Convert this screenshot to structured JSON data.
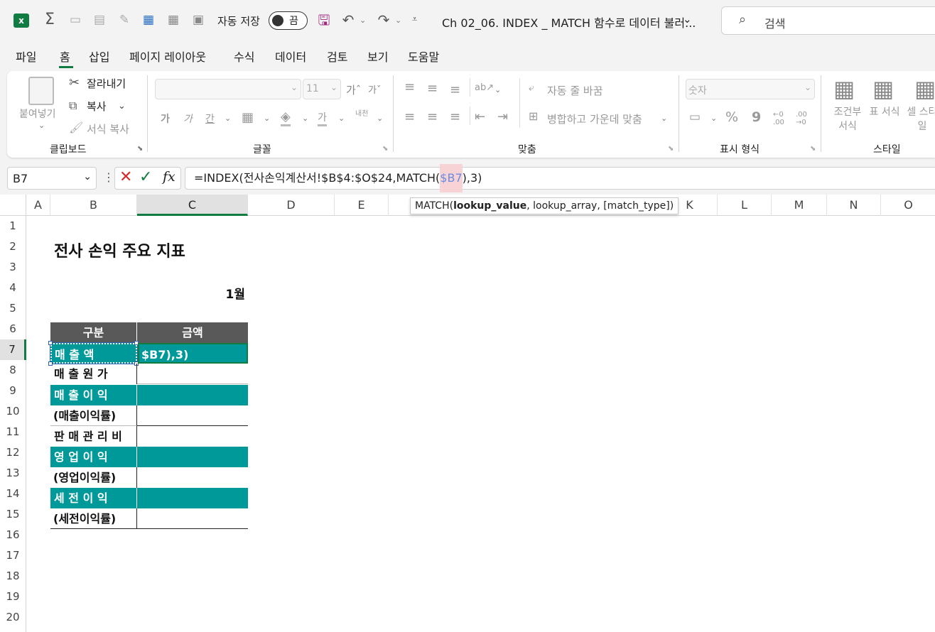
{
  "titlebar": {
    "autosave_label": "자동 저장",
    "autosave_state": "끔",
    "doc_title": "Ch 02_06. INDEX _ MATCH 함수로 데이터 불러...",
    "search_placeholder": "검색"
  },
  "menu": [
    "파일",
    "홈",
    "삽입",
    "페이지 레이아웃",
    "수식",
    "데이터",
    "검토",
    "보기",
    "도움말"
  ],
  "ribbon": {
    "clipboard": {
      "paste": "붙여넣기",
      "cut": "잘라내기",
      "copy": "복사",
      "format_painter": "서식 복사",
      "group": "클립보드"
    },
    "font": {
      "size": "11",
      "bold": "가",
      "italic": "가",
      "underline": "간",
      "font_color": "가",
      "phonetic": "내천",
      "group": "글꼴"
    },
    "alignment": {
      "wrap": "자동 줄 바꿈",
      "merge": "병합하고 가운데 맞춤",
      "group": "맞춤"
    },
    "number": {
      "format": "숫자",
      "percent": "%",
      "comma": "9",
      "inc_dec": "←0 .00",
      "dec_dec": ".00 →0",
      "group": "표시 형식"
    },
    "styles": {
      "conditional": "조건부 서식",
      "table": "표 서식",
      "cell": "셀 스타일",
      "group": "스타일"
    }
  },
  "formula_bar": {
    "name_box": "B7",
    "formula_prefix": "=INDEX(전사손익계산서!$B$4:$O$24,MATCH(",
    "formula_ref": "$B7",
    "formula_suffix": "),3)",
    "tooltip_fn": "MATCH(",
    "tooltip_arg1": "lookup_value",
    "tooltip_rest": ", lookup_array, [match_type])"
  },
  "columns": [
    "A",
    "B",
    "C",
    "D",
    "E",
    "K",
    "L",
    "M",
    "N",
    "O"
  ],
  "rows": [
    "1",
    "2",
    "3",
    "4",
    "5",
    "6",
    "7",
    "8",
    "9",
    "10",
    "11",
    "12",
    "13",
    "14",
    "15",
    "16",
    "17",
    "18",
    "19",
    "20"
  ],
  "sheet": {
    "title": "전사 손익 주요 지표",
    "month": "1월",
    "header_b": "구분",
    "header_c": "금액",
    "c7_edit": "$B7),3)",
    "items": [
      "매   출   액",
      "매 출 원 가",
      "매 출 이 익",
      "(매출이익률)",
      "판 매 관 리 비",
      "영 업 이 익",
      "(영업이익률)",
      "세 전 이 익",
      "(세전이익률)"
    ]
  },
  "colors": {
    "teal": "#00999a",
    "header_gray": "#595959",
    "excel_green": "#107c41",
    "save_purple": "#a0287d"
  }
}
